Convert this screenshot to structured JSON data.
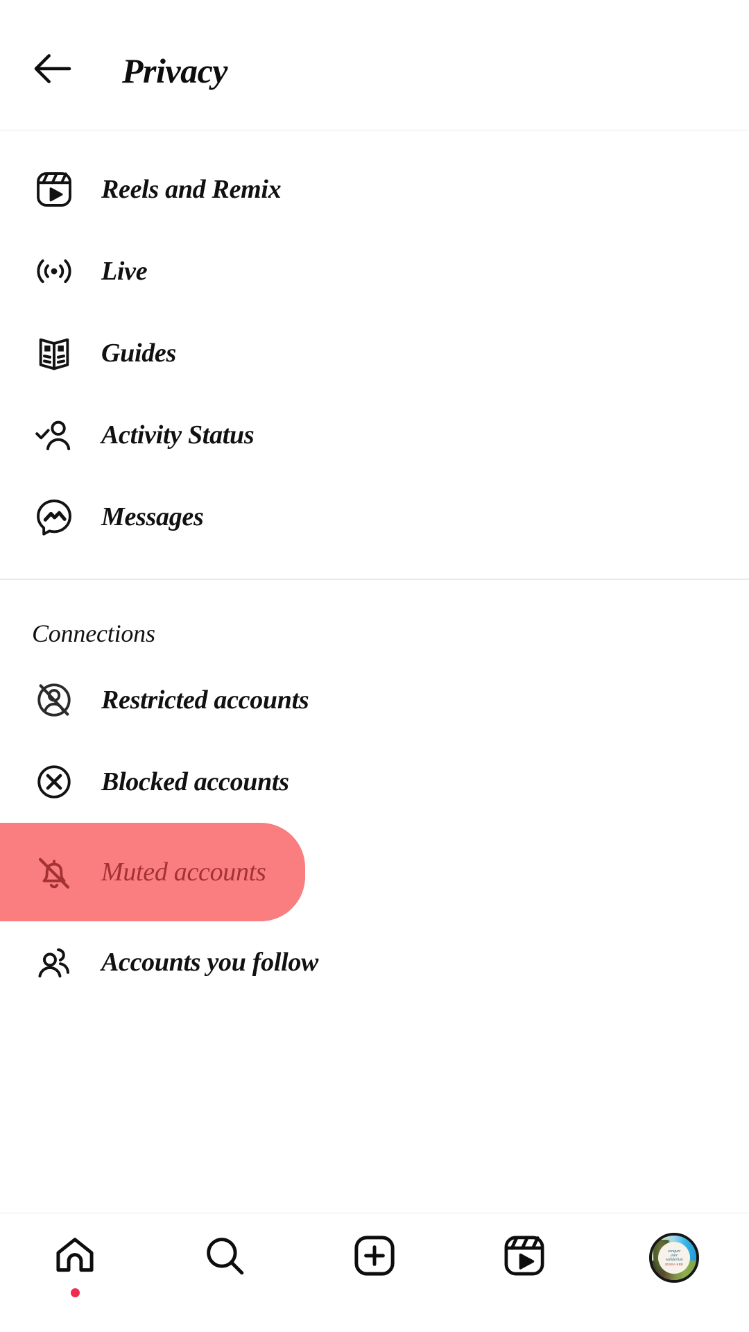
{
  "statusbar": {
    "left_text": "",
    "right_text": ""
  },
  "header": {
    "back_icon": "back-arrow-icon",
    "title": "Privacy"
  },
  "sections": [
    {
      "id": "interactions",
      "heading": null,
      "items": [
        {
          "id": "reels-and-remix",
          "label": "Reels and Remix",
          "icon": "reels-icon",
          "highlighted": false
        },
        {
          "id": "live",
          "label": "Live",
          "icon": "live-broadcast-icon",
          "highlighted": false
        },
        {
          "id": "guides",
          "label": "Guides",
          "icon": "guides-book-icon",
          "highlighted": false
        },
        {
          "id": "activity-status",
          "label": "Activity Status",
          "icon": "person-check-icon",
          "highlighted": false
        },
        {
          "id": "messages",
          "label": "Messages",
          "icon": "messenger-icon",
          "highlighted": false
        }
      ]
    },
    {
      "id": "connections",
      "heading": "Connections",
      "items": [
        {
          "id": "restricted-accounts",
          "label": "Restricted accounts",
          "icon": "restricted-person-icon",
          "highlighted": false
        },
        {
          "id": "blocked-accounts",
          "label": "Blocked accounts",
          "icon": "blocked-x-circle-icon",
          "highlighted": false
        },
        {
          "id": "muted-accounts",
          "label": "Muted accounts",
          "icon": "muted-bell-icon",
          "highlighted": true
        },
        {
          "id": "accounts-you-follow",
          "label": "Accounts you follow",
          "icon": "two-people-icon",
          "highlighted": false
        }
      ]
    }
  ],
  "bottom_nav": [
    {
      "id": "home",
      "icon": "home-icon",
      "has_dot": true
    },
    {
      "id": "search",
      "icon": "search-icon",
      "has_dot": false
    },
    {
      "id": "create",
      "icon": "plus-square-icon",
      "has_dot": false
    },
    {
      "id": "reels",
      "icon": "reels-icon",
      "has_dot": false
    },
    {
      "id": "profile",
      "icon": "profile-avatar",
      "has_dot": false
    }
  ],
  "avatar": {
    "line1": "conquer",
    "line2": "your",
    "line3": "wanderlust",
    "line4": "JESSA KRE"
  },
  "colors": {
    "highlight_background": "#fa7e80",
    "highlight_text": "#a33232",
    "icon": "#121212",
    "text": "#111111",
    "divider": "#e9e9e9",
    "notification_dot": "#ef2b4e"
  }
}
